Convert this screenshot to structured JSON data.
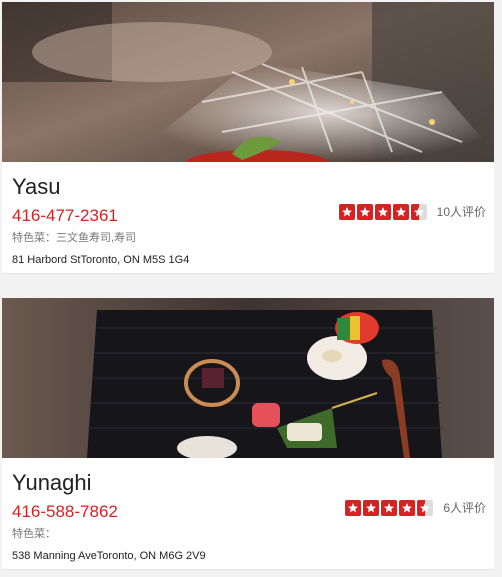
{
  "restaurants": [
    {
      "name": "Yasu",
      "phone": "416-477-2361",
      "specialty_label": "特色菜：",
      "specialty_value": "三文鱼寿司,寿司",
      "address": "81 Harbord StToronto, ON M5S 1G4",
      "rating": 4.5,
      "reviews": "10人评价",
      "photo_icon": "sushi-plate-photo"
    },
    {
      "name": "Yunaghi",
      "phone": "416-588-7862",
      "specialty_label": "特色菜：",
      "specialty_value": "",
      "address": "538 Manning AveToronto, ON M6G 2V9",
      "rating": 4.5,
      "reviews": "6人评价",
      "photo_icon": "kaiseki-tray-photo"
    }
  ],
  "colors": {
    "accent": "#d32323",
    "star_empty": "#dddddd"
  }
}
